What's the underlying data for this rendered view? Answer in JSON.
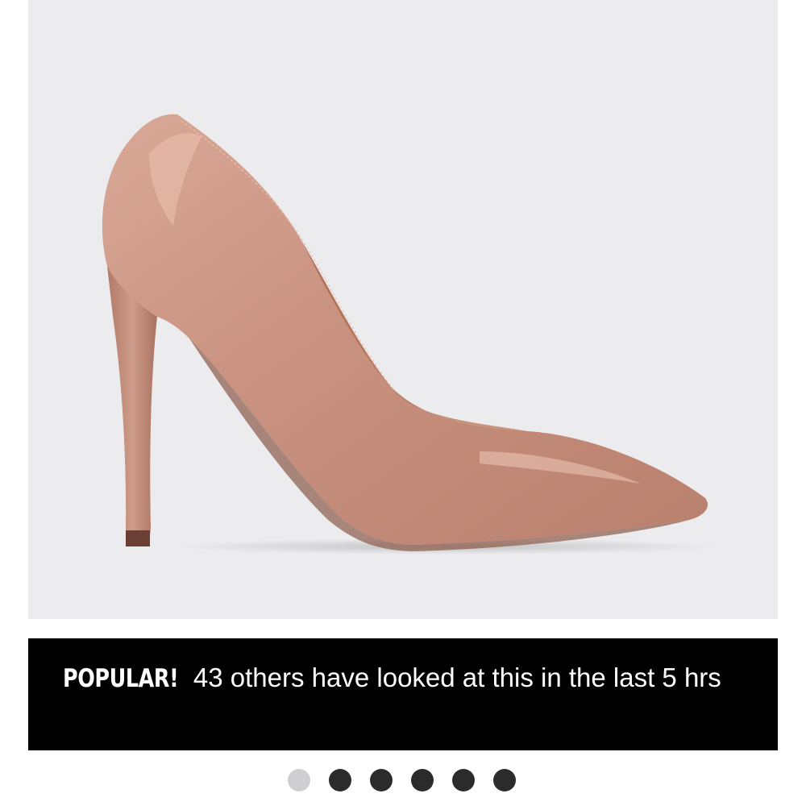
{
  "product": {
    "image_alt": "nude patent pointed stiletto court shoe",
    "background_color": "#ececee",
    "shoe_color": "#c99583"
  },
  "banner": {
    "badge": "POPULAR!",
    "message": "43 others have looked at this in the last 5 hrs"
  },
  "carousel": {
    "total_slides": 6,
    "active_index": 0
  }
}
